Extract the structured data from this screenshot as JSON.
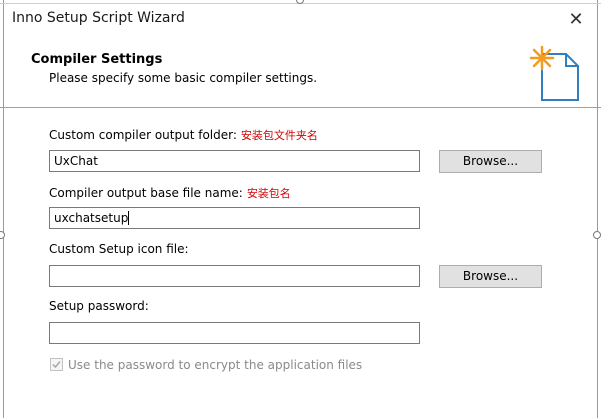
{
  "window": {
    "title": "Inno Setup Script Wizard"
  },
  "header": {
    "title": "Compiler Settings",
    "subtitle": "Please specify some basic compiler settings."
  },
  "fields": {
    "output_folder": {
      "label": "Custom compiler output folder:",
      "note": "安装包文件夹名",
      "value": "UxChat"
    },
    "base_filename": {
      "label": "Compiler output base file name:",
      "note": "安装包名",
      "value": "uxchatsetup"
    },
    "icon_file": {
      "label": "Custom Setup icon file:",
      "value": ""
    },
    "password": {
      "label": "Setup password:",
      "value": ""
    }
  },
  "buttons": {
    "browse_output": "Browse...",
    "browse_icon": "Browse..."
  },
  "encrypt": {
    "label": "Use the password to encrypt the application files",
    "checked": true,
    "enabled": false
  },
  "colors": {
    "note_red": "#d40000",
    "icon_orange": "#f39c1f",
    "icon_blue": "#2f7fc1"
  },
  "icons": {
    "close": "close-icon",
    "wizard": "new-file-sparkle-icon",
    "check": "checkmark-icon"
  }
}
